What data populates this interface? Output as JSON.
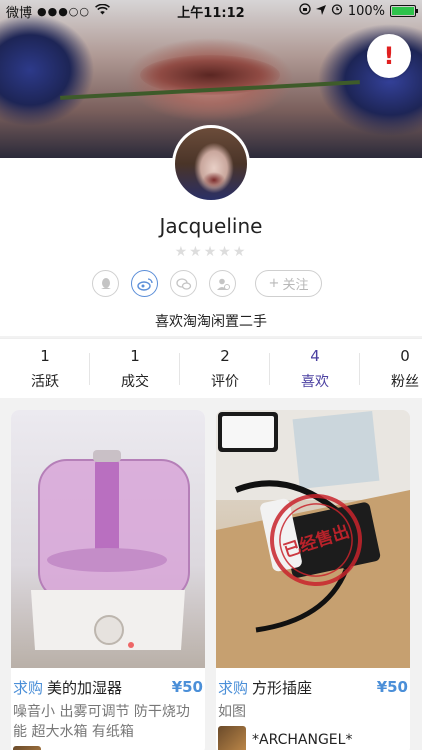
{
  "status_bar": {
    "carrier": "微博",
    "signal": "●●●○○",
    "time": "上午11:12",
    "battery": "100%",
    "battery_level": 1.0
  },
  "profile": {
    "name": "Jacqueline",
    "stars": "★★★★★",
    "follow_label": "关注",
    "follow_prefix": "+",
    "bio": "喜欢淘淘闲置二手"
  },
  "alert": {
    "label": "!"
  },
  "stats": [
    {
      "num": "1",
      "label": "活跃"
    },
    {
      "num": "1",
      "label": "成交"
    },
    {
      "num": "2",
      "label": "评价"
    },
    {
      "num": "4",
      "label": "喜欢"
    },
    {
      "num": "0",
      "label": "粉丝"
    }
  ],
  "products": [
    {
      "tag": "求购",
      "title": "美的加湿器",
      "price": "¥50",
      "desc": "噪音小 出雾可调节 防干烧功能 超大水箱 有纸箱",
      "seller": ""
    },
    {
      "tag": "求购",
      "title": "方形插座",
      "price": "¥50",
      "desc": "如图",
      "seller": "*ARCHANGEL*",
      "stamp": "已经售出"
    }
  ],
  "colors": {
    "accent": "#4b8fd8",
    "active_tab": "#4a3fa0",
    "alert": "#e02020"
  }
}
